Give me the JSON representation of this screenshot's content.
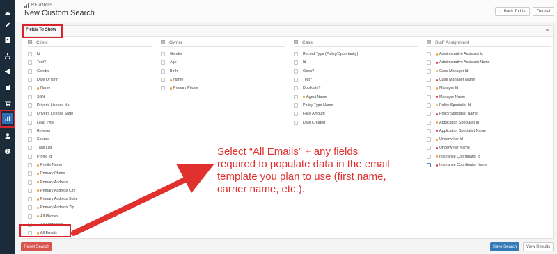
{
  "rail": {
    "items": [
      {
        "name": "dashboard-icon"
      },
      {
        "name": "edit-icon"
      },
      {
        "name": "contacts-icon"
      },
      {
        "name": "org-chart-icon"
      },
      {
        "name": "megaphone-icon"
      },
      {
        "name": "book-icon"
      },
      {
        "name": "cart-icon"
      },
      {
        "name": "chart-icon",
        "active": true
      },
      {
        "name": "user-icon"
      },
      {
        "name": "help-icon"
      }
    ]
  },
  "header": {
    "breadcrumb": "REPORTS",
    "title": "New Custom Search",
    "back_label": "Back To List",
    "tutorial_label": "Tutorial"
  },
  "panel": {
    "tab": "Fields To Show",
    "menu_icon": "≡"
  },
  "columns": [
    {
      "title": "Client",
      "fields": [
        {
          "label": "Id"
        },
        {
          "label": "Test?"
        },
        {
          "label": "Gender"
        },
        {
          "label": "Date Of Birth"
        },
        {
          "label": "Name",
          "dot": "orange"
        },
        {
          "label": "SSN"
        },
        {
          "label": "Driver's License No."
        },
        {
          "label": "Driver's License State"
        },
        {
          "label": "Lead Type"
        },
        {
          "label": "Referrer"
        },
        {
          "label": "Source"
        },
        {
          "label": "Tags List"
        },
        {
          "label": "Profile Id"
        },
        {
          "label": "Profile Name",
          "dot": "orange"
        },
        {
          "label": "Primary Phone",
          "dot": "orange"
        },
        {
          "label": "Primary Address",
          "dot": "orange"
        },
        {
          "label": "Primary Address City",
          "dot": "orange"
        },
        {
          "label": "Primary Address State",
          "dot": "orange"
        },
        {
          "label": "Primary Address Zip",
          "dot": "orange"
        },
        {
          "label": "All Phones",
          "dot": "orange"
        },
        {
          "label": "All Addresses",
          "dot": "orange"
        },
        {
          "label": "All Emails",
          "dot": "orange"
        }
      ]
    },
    {
      "title": "Owner",
      "fields": [
        {
          "label": "Gender"
        },
        {
          "label": "Age"
        },
        {
          "label": "Birth"
        },
        {
          "label": "Name",
          "dot": "orange"
        },
        {
          "label": "Primary Phone",
          "dot": "orange"
        }
      ]
    },
    {
      "title": "Case",
      "fields": [
        {
          "label": "Record Type (Policy/Opportunity)"
        },
        {
          "label": "Id"
        },
        {
          "label": "Open?"
        },
        {
          "label": "Test?"
        },
        {
          "label": "Duplicate?"
        },
        {
          "label": "Agent Name",
          "dot": "orange"
        },
        {
          "label": "Policy Type Name"
        },
        {
          "label": "Face Amount"
        },
        {
          "label": "Date Created"
        }
      ]
    },
    {
      "title": "Staff Assignment",
      "fields": [
        {
          "label": "Administrative Assistant Id",
          "dot": "orange"
        },
        {
          "label": "Administrative Assistant Name",
          "dot": "red"
        },
        {
          "label": "Case Manager Id",
          "dot": "orange"
        },
        {
          "label": "Case Manager Name",
          "dot": "red"
        },
        {
          "label": "Manager Id",
          "dot": "orange"
        },
        {
          "label": "Manager Name",
          "dot": "red"
        },
        {
          "label": "Policy Specialist Id",
          "dot": "orange"
        },
        {
          "label": "Policy Specialist Name",
          "dot": "red"
        },
        {
          "label": "Application Specialist Id",
          "dot": "orange"
        },
        {
          "label": "Application Specialist Name",
          "dot": "red"
        },
        {
          "label": "Underwriter Id",
          "dot": "orange"
        },
        {
          "label": "Underwriter Name",
          "dot": "red"
        },
        {
          "label": "Insurance Coordinator Id",
          "dot": "orange"
        },
        {
          "label": "Insurance Coordinator Name",
          "dot": "red",
          "blue": true
        }
      ]
    }
  ],
  "footer": {
    "reset_label": "Reset Search",
    "save_label": "Save Search",
    "view_label": "View Results"
  },
  "annotation": {
    "text": "Select “All Emails” + any fields required to populate data in the email template you plan to use (first name, carrier name, etc.).",
    "color": "#e0312f"
  },
  "colors": {
    "rail_bg": "#1b2b3a",
    "rail_active": "#2e6fb5",
    "highlight_red": "#d9232d",
    "dot_orange": "#f29a2e",
    "dot_red": "#e0312f",
    "save_blue": "#337ab7",
    "reset_red": "#d9534f"
  }
}
